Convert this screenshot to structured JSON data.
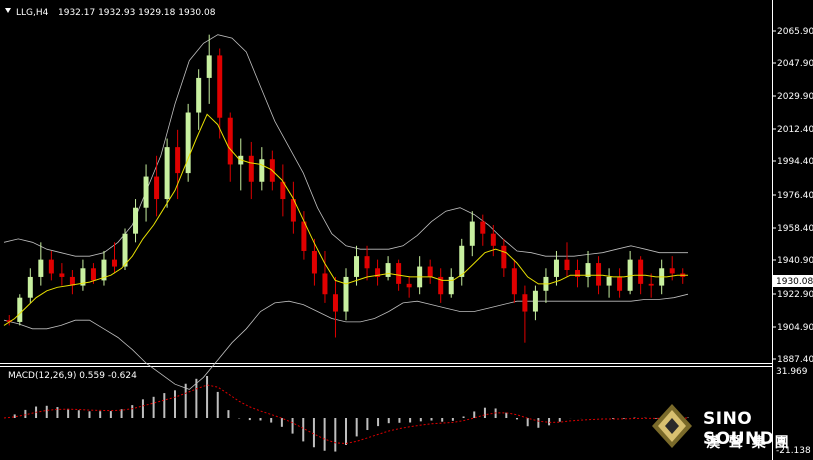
{
  "window": {
    "symbol": "LLG,H4",
    "ohlc": "1932.17 1932.93 1929.18 1930.08"
  },
  "price_axis": {
    "ticks": [
      "2065.90",
      "2047.90",
      "2029.90",
      "2012.40",
      "1994.40",
      "1976.40",
      "1958.40",
      "1940.90",
      "1922.90",
      "1904.90",
      "1887.40"
    ],
    "current_label": "1930.08"
  },
  "macd": {
    "label": "MACD(12,26,9) 0.559 -0.624",
    "axis_top": "31.969",
    "axis_bottom": "-21.138"
  },
  "logo": {
    "brand": "SINO SOUND",
    "chinese": "漢 聲 集 團"
  },
  "colors": {
    "bull": "#c8f0a0",
    "bear": "#e00000",
    "ma": "#e8e000",
    "band": "#bfbfbf",
    "signal": "#e00000",
    "grid": "#ffffff"
  },
  "chart_data": {
    "type": "candlestick",
    "ylim": [
      1882,
      2075
    ],
    "candles": [
      [
        1905,
        1908,
        1902,
        1904
      ],
      [
        1904,
        1920,
        1902,
        1918
      ],
      [
        1918,
        1935,
        1915,
        1930
      ],
      [
        1930,
        1950,
        1925,
        1940
      ],
      [
        1940,
        1945,
        1928,
        1932
      ],
      [
        1932,
        1938,
        1925,
        1930
      ],
      [
        1930,
        1934,
        1920,
        1925
      ],
      [
        1925,
        1940,
        1922,
        1935
      ],
      [
        1935,
        1938,
        1926,
        1928
      ],
      [
        1928,
        1945,
        1925,
        1940
      ],
      [
        1940,
        1950,
        1932,
        1936
      ],
      [
        1936,
        1958,
        1934,
        1955
      ],
      [
        1955,
        1975,
        1950,
        1970
      ],
      [
        1970,
        1995,
        1962,
        1988
      ],
      [
        1988,
        2000,
        1965,
        1975
      ],
      [
        1975,
        2010,
        1970,
        2005
      ],
      [
        2005,
        2015,
        1975,
        1990
      ],
      [
        1990,
        2030,
        1985,
        2025
      ],
      [
        2025,
        2050,
        2015,
        2045
      ],
      [
        2045,
        2070,
        2030,
        2058
      ],
      [
        2058,
        2062,
        2010,
        2022
      ],
      [
        2022,
        2025,
        1985,
        1995
      ],
      [
        1995,
        2010,
        1980,
        2000
      ],
      [
        2000,
        2008,
        1975,
        1985
      ],
      [
        1985,
        2005,
        1980,
        1998
      ],
      [
        1998,
        2003,
        1980,
        1985
      ],
      [
        1985,
        1995,
        1965,
        1975
      ],
      [
        1975,
        1985,
        1955,
        1962
      ],
      [
        1962,
        1968,
        1940,
        1945
      ],
      [
        1945,
        1952,
        1925,
        1932
      ],
      [
        1932,
        1945,
        1915,
        1920
      ],
      [
        1920,
        1930,
        1895,
        1910
      ],
      [
        1910,
        1935,
        1905,
        1930
      ],
      [
        1930,
        1948,
        1925,
        1942
      ],
      [
        1942,
        1948,
        1928,
        1935
      ],
      [
        1935,
        1940,
        1925,
        1930
      ],
      [
        1930,
        1942,
        1928,
        1938
      ],
      [
        1938,
        1940,
        1922,
        1926
      ],
      [
        1926,
        1930,
        1918,
        1924
      ],
      [
        1924,
        1942,
        1920,
        1936
      ],
      [
        1936,
        1940,
        1926,
        1930
      ],
      [
        1930,
        1935,
        1915,
        1920
      ],
      [
        1920,
        1935,
        1918,
        1930
      ],
      [
        1930,
        1952,
        1925,
        1948
      ],
      [
        1948,
        1968,
        1942,
        1962
      ],
      [
        1962,
        1966,
        1948,
        1955
      ],
      [
        1955,
        1960,
        1942,
        1948
      ],
      [
        1948,
        1952,
        1930,
        1935
      ],
      [
        1935,
        1940,
        1915,
        1920
      ],
      [
        1920,
        1925,
        1892,
        1910
      ],
      [
        1910,
        1925,
        1905,
        1922
      ],
      [
        1922,
        1935,
        1915,
        1930
      ],
      [
        1930,
        1945,
        1925,
        1940
      ],
      [
        1940,
        1950,
        1930,
        1934
      ],
      [
        1934,
        1940,
        1924,
        1930
      ],
      [
        1930,
        1945,
        1924,
        1938
      ],
      [
        1938,
        1942,
        1920,
        1925
      ],
      [
        1925,
        1935,
        1918,
        1930
      ],
      [
        1930,
        1935,
        1918,
        1922
      ],
      [
        1922,
        1945,
        1920,
        1940
      ],
      [
        1940,
        1942,
        1920,
        1926
      ],
      [
        1926,
        1932,
        1918,
        1925
      ],
      [
        1925,
        1940,
        1920,
        1935
      ],
      [
        1935,
        1942,
        1928,
        1932
      ],
      [
        1932,
        1935,
        1926,
        1930
      ]
    ],
    "ma": [
      1902,
      1906,
      1912,
      1918,
      1922,
      1924,
      1925,
      1926,
      1927,
      1929,
      1931,
      1935,
      1942,
      1952,
      1960,
      1970,
      1980,
      1995,
      2010,
      2024,
      2018,
      2005,
      1998,
      1996,
      1995,
      1992,
      1986,
      1976,
      1963,
      1950,
      1938,
      1928,
      1926,
      1928,
      1930,
      1931,
      1932,
      1931,
      1930,
      1930,
      1930,
      1928,
      1928,
      1932,
      1938,
      1944,
      1946,
      1944,
      1938,
      1930,
      1926,
      1926,
      1928,
      1931,
      1931,
      1931,
      1931,
      1930,
      1930,
      1931,
      1931,
      1930,
      1930,
      1931,
      1931
    ],
    "band_upper": [
      1950,
      1952,
      1950,
      1946,
      1944,
      1942,
      1942,
      1944,
      1950,
      1960,
      1980,
      2000,
      2030,
      2055,
      2065,
      2070,
      2068,
      2060,
      2040,
      2020,
      2005,
      1990,
      1970,
      1955,
      1948,
      1946,
      1946,
      1946,
      1948,
      1954,
      1962,
      1968,
      1970,
      1966,
      1960,
      1952,
      1945,
      1944,
      1942,
      1942,
      1942,
      1943,
      1944,
      1946,
      1948,
      1946,
      1944,
      1944,
      1944
    ],
    "band_lower": [
      1905,
      1903,
      1900,
      1900,
      1902,
      1905,
      1905,
      1900,
      1895,
      1888,
      1880,
      1874,
      1868,
      1865,
      1872,
      1882,
      1892,
      1900,
      1910,
      1915,
      1916,
      1914,
      1910,
      1906,
      1904,
      1904,
      1906,
      1910,
      1915,
      1916,
      1914,
      1912,
      1910,
      1910,
      1912,
      1914,
      1916,
      1916,
      1916,
      1916,
      1916,
      1916,
      1916,
      1916,
      1916,
      1917,
      1917,
      1918,
      1920
    ]
  }
}
